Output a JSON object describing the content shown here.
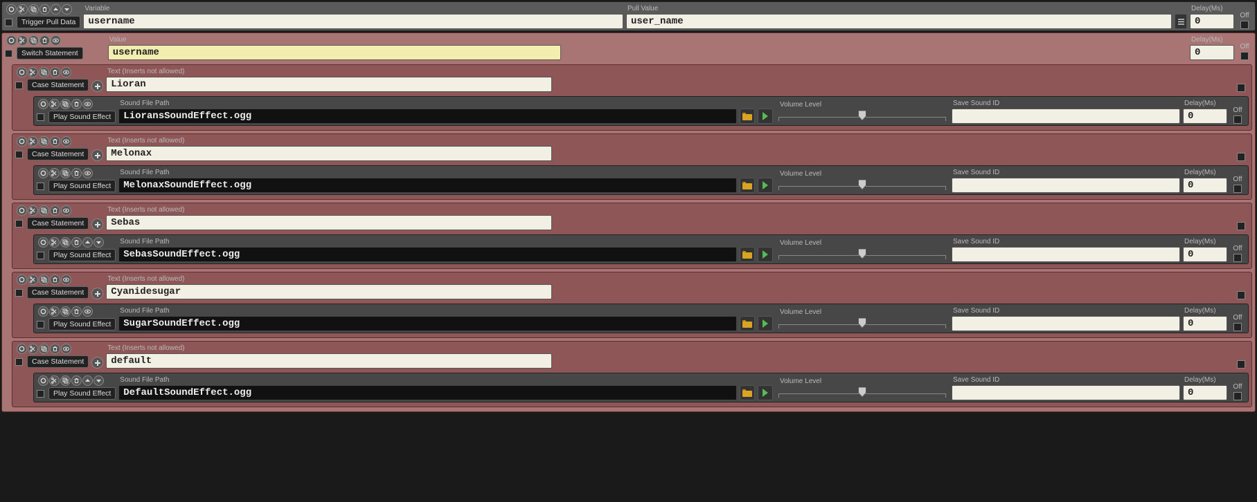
{
  "labels": {
    "variable": "Variable",
    "pull_value": "Pull Value",
    "delay_ms": "Delay(Ms)",
    "off": "Off",
    "value": "Value",
    "text_noinsert": "Text (Inserts not allowed)",
    "sound_file_path": "Sound File Path",
    "volume_level": "Volume Level",
    "save_sound_id": "Save Sound ID"
  },
  "titles": {
    "trigger_pull_data": "Trigger Pull Data",
    "switch_statement": "Switch Statement",
    "case_statement": "Case Statement",
    "play_sound_effect": "Play Sound Effect"
  },
  "trigger": {
    "variable": "username",
    "pull_value": "user_name",
    "delay": "0"
  },
  "switch": {
    "value": "username",
    "delay": "0"
  },
  "cases": [
    {
      "text": "Lioran",
      "sound_path": "LioransSoundEffect.ogg",
      "save_id": "",
      "delay": "0",
      "has_updown": false
    },
    {
      "text": "Melonax",
      "sound_path": "MelonaxSoundEffect.ogg",
      "save_id": "",
      "delay": "0",
      "has_updown": false
    },
    {
      "text": "Sebas",
      "sound_path": "SebasSoundEffect.ogg",
      "save_id": "",
      "delay": "0",
      "has_updown": true
    },
    {
      "text": "Cyanidesugar",
      "sound_path": "SugarSoundEffect.ogg",
      "save_id": "",
      "delay": "0",
      "has_updown": false
    },
    {
      "text": "default",
      "sound_path": "DefaultSoundEffect.ogg",
      "save_id": "",
      "delay": "0",
      "has_updown": true
    }
  ]
}
